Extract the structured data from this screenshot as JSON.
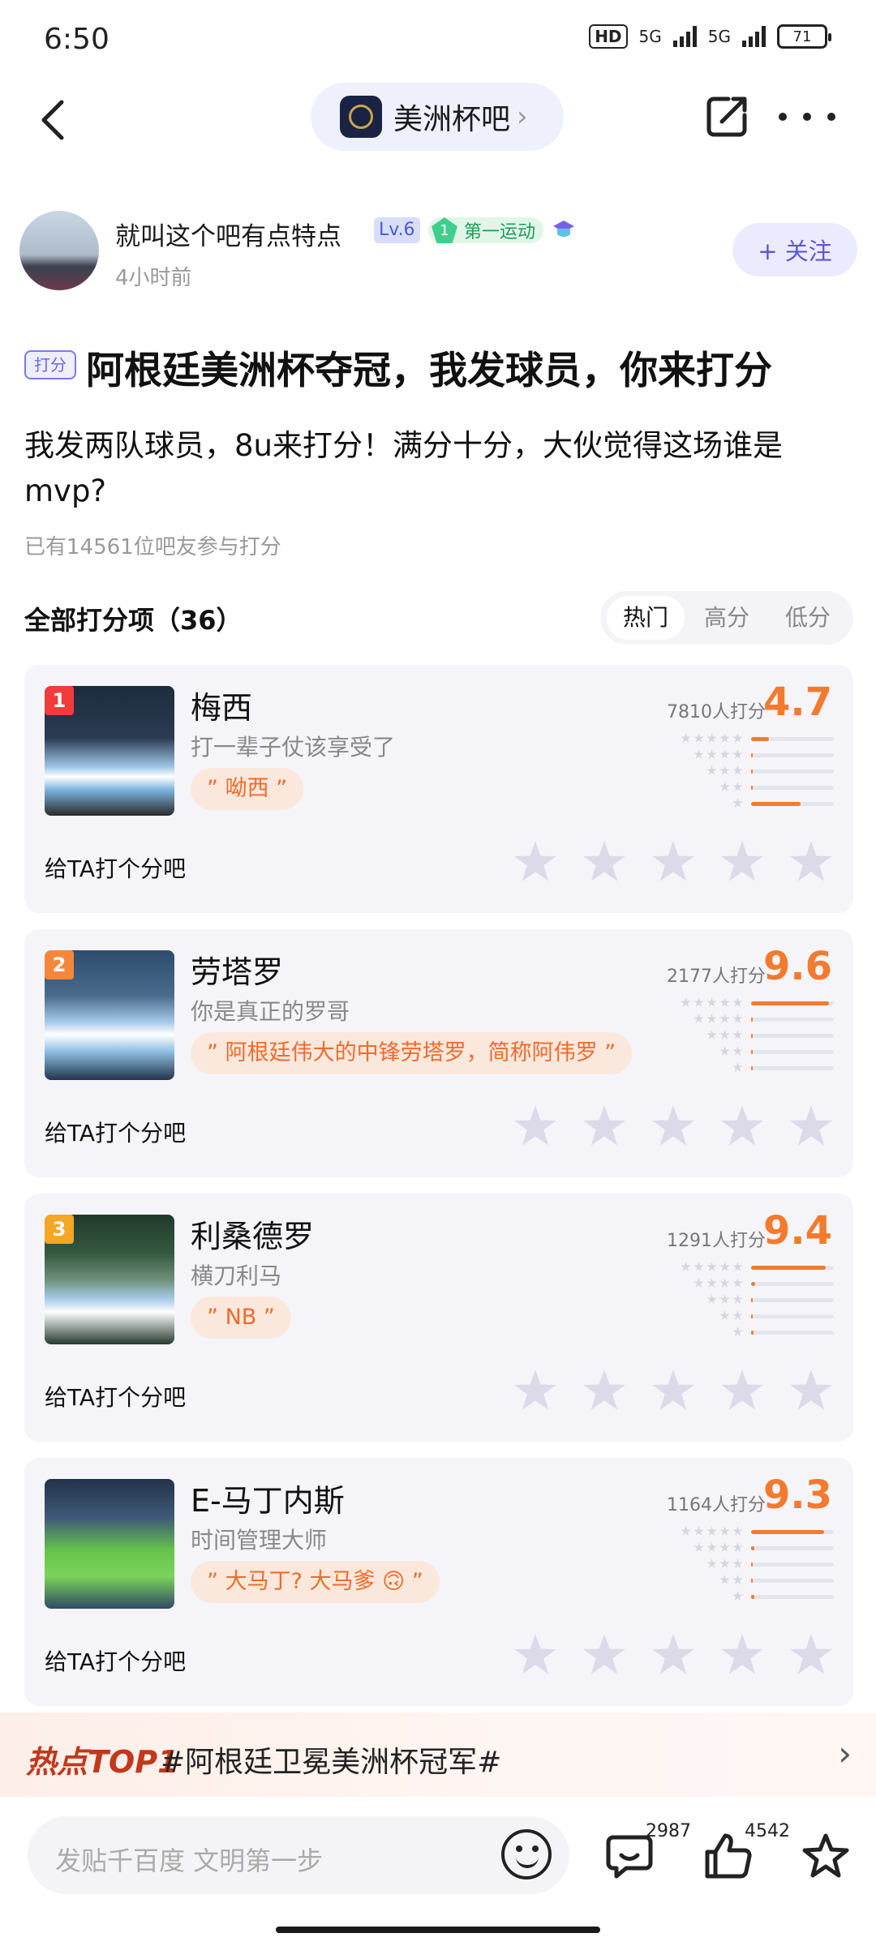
{
  "status": {
    "time": "6:50",
    "hd": "HD",
    "net1": "5G",
    "net2": "5G",
    "battery": "71"
  },
  "nav": {
    "forum_name": "美洲杯吧",
    "chevron": "›"
  },
  "author": {
    "name": "就叫这个吧有点特点",
    "level": "Lv.6",
    "tag_num": "1",
    "tag_label": "第一运动",
    "time": "4小时前",
    "follow_label": "+ 关注"
  },
  "post": {
    "badge": "打分",
    "title": "阿根廷美洲杯夺冠，我发球员，你来打分",
    "desc": "我发两队球员，8u来打分！满分十分，大伙觉得这场谁是mvp?",
    "participants": "已有14561位吧友参与打分"
  },
  "section": {
    "title": "全部打分项（36）",
    "sort_tabs": [
      "热门",
      "高分",
      "低分"
    ],
    "active_sort": "热门"
  },
  "rate_prompt": "给TA打个分吧",
  "players": [
    {
      "rank": "1",
      "rank_color": "#f23c3c",
      "name": "梅西",
      "sub": "打一辈子仗该享受了",
      "quote": "” 呦西 ”",
      "count": "7810人打分",
      "score": "4.7",
      "dist": [
        0.22,
        0.0,
        0.0,
        0.02,
        0.6
      ]
    },
    {
      "rank": "2",
      "rank_color": "#f5873a",
      "name": "劳塔罗",
      "sub": "你是真正的罗哥",
      "quote": "” 阿根廷伟大的中锋劳塔罗，简称阿伟罗 ”",
      "count": "2177人打分",
      "score": "9.6",
      "dist": [
        0.94,
        0.02,
        0.01,
        0.01,
        0.02
      ]
    },
    {
      "rank": "3",
      "rank_color": "#f5a623",
      "name": "利桑德罗",
      "sub": "横刀利马",
      "quote": "” NB ”",
      "count": "1291人打分",
      "score": "9.4",
      "dist": [
        0.9,
        0.05,
        0.01,
        0.01,
        0.03
      ]
    },
    {
      "rank": "",
      "rank_color": "",
      "name": "E-马丁内斯",
      "sub": "时间管理大师",
      "quote": "” 大马丁? 大马爹 🙃 ”",
      "count": "1164人打分",
      "score": "9.3",
      "dist": [
        0.88,
        0.04,
        0.02,
        0.01,
        0.04
      ]
    }
  ],
  "hot": {
    "label": "热点TOP1",
    "text": "#阿根廷卫冕美洲杯冠军#"
  },
  "bottom": {
    "placeholder": "发贴千百度 文明第一步",
    "comments": "2987",
    "likes": "4542"
  }
}
